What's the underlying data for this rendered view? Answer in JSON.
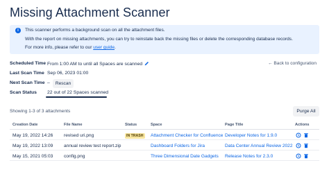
{
  "page_title": "Missing Attachment Scanner",
  "info": {
    "line1": "This scanner performs a background scan on all the attachment files.",
    "line2": "With the report on missing attachments, you can try to reinstate back the missing files or delete the corresponding database records.",
    "line3_prefix": "For more info, please refer to our ",
    "line3_link": "user guide",
    "line3_suffix": "."
  },
  "fields": {
    "scheduled_label": "Scheduled Time",
    "scheduled_value": "From 1:00 AM to until all Spaces are scanned",
    "last_scan_label": "Last Scan Time",
    "last_scan_value": "Sep 06, 2023 01:00",
    "next_scan_label": "Next Scan Time",
    "next_scan_value": "–",
    "rescan_label": "Rescan",
    "status_label": "Scan Status",
    "status_value": "22 out of 22 Spaces scanned",
    "back_label": "← Back to configuration"
  },
  "showing": "Showing 1-3 of 3 attachments",
  "purge_label": "Purge All",
  "columns": [
    "Creation Date",
    "File Name",
    "Status",
    "Space",
    "Page Title",
    "Actions"
  ],
  "rows": [
    {
      "date": "May 19, 2022 14:26",
      "file": "revised uri.png",
      "status": "IN TRASH",
      "space": "Attachment Checker for Confluence",
      "page": "Developer Notes for 1.9.0"
    },
    {
      "date": "May 19, 2022 13:09",
      "file": "annual review test report.zip",
      "status": "",
      "space": "Dashboard Folders for Jira",
      "page": "Data Center Annual Review 2022"
    },
    {
      "date": "May 15, 2021 05:03",
      "file": "config.png",
      "status": "",
      "space": "Three Dimensional Date Gadgets",
      "page": "Release Notes for 2.3.0"
    }
  ],
  "colors": {
    "link": "#0c66e4",
    "info_bg": "#e9f2ff",
    "lozenge_bg": "#f8e6a0"
  },
  "icons": [
    "info-icon",
    "pencil-icon",
    "restore-icon",
    "trash-icon"
  ]
}
